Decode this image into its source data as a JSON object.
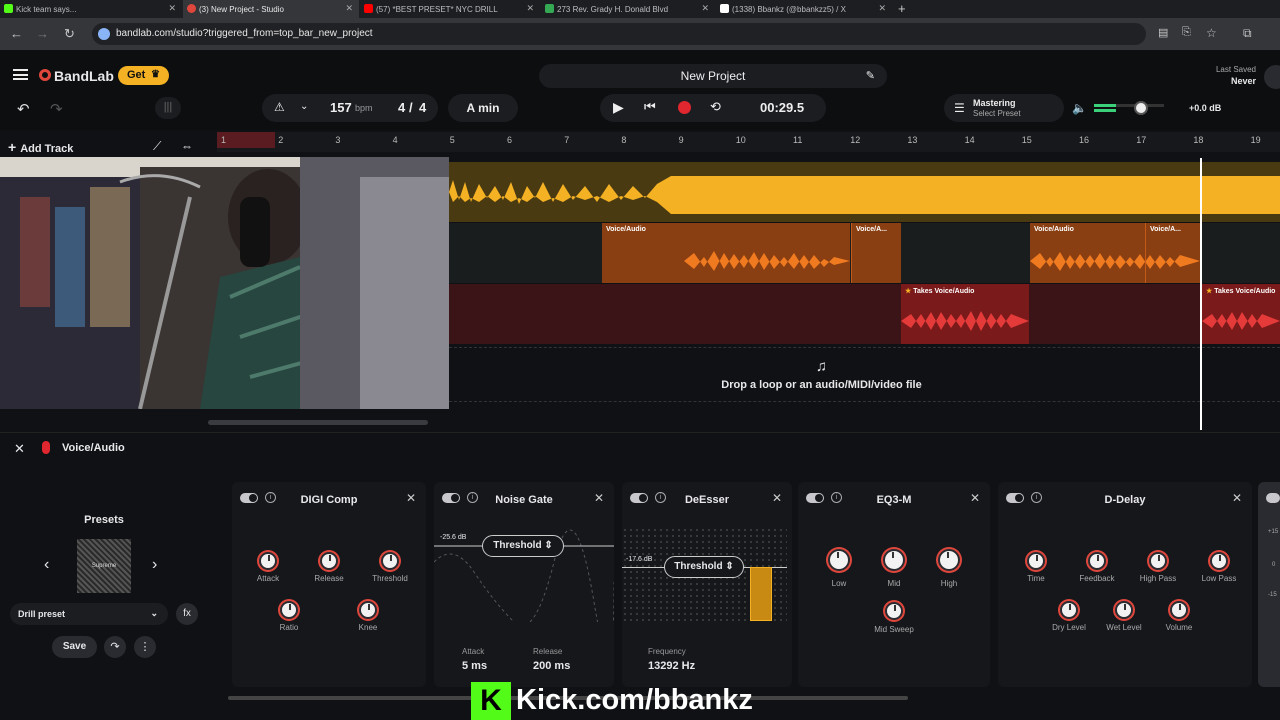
{
  "browser": {
    "tabs": [
      {
        "label": "Kick team says...",
        "color": "#53fc18"
      },
      {
        "label": "(3) New Project - Studio",
        "color": "#e0473c"
      },
      {
        "label": "(57) *BEST PRESET* NYC DRILL",
        "color": "#ff0000"
      },
      {
        "label": "273 Rev. Grady H. Donald Blvd",
        "color": "#34a853"
      },
      {
        "label": "(1338) Bbankz (@bbankzz5) / X",
        "color": "#ffffff"
      }
    ],
    "url": "bandlab.com/studio?triggered_from=top_bar_new_project",
    "new_tab": "+"
  },
  "header": {
    "brand": "BandLab",
    "get_label": "Get",
    "project_title": "New Project",
    "last_saved_label": "Last Saved",
    "last_saved_value": "Never",
    "bpm": "157",
    "bpm_unit": "bpm",
    "time_sig_num": "4",
    "time_sig_sep": "/",
    "time_sig_den": "4",
    "key": "A min",
    "time": "00:29.5",
    "mastering_label": "Mastering",
    "mastering_preset": "Select Preset",
    "volume_db": "+0.0 dB",
    "volume_level": 0.62
  },
  "timeline": {
    "add_track": "Add Track",
    "bars": [
      "1",
      "2",
      "3",
      "4",
      "5",
      "6",
      "7",
      "8",
      "9",
      "10",
      "11",
      "12",
      "13",
      "14",
      "15",
      "16",
      "17",
      "18",
      "19"
    ],
    "clip_label": "Voice/Audio",
    "clip_label_short": "Voice/A...",
    "takes": "Takes",
    "drop_hint": "Drop a loop or an audio/MIDI/video file"
  },
  "panel": {
    "track_name": "Voice/Audio",
    "presets_label": "Presets",
    "preset_thumb": "Supreme",
    "preset_name": "Drill preset",
    "save": "Save"
  },
  "effects": [
    {
      "name": "DIGI Comp",
      "knobs": [
        "Attack",
        "Release",
        "Threshold",
        "Ratio",
        "Knee"
      ]
    },
    {
      "name": "Noise Gate",
      "threshold_label": "Threshold",
      "threshold_db": "-25.6 dB",
      "attack_label": "Attack",
      "attack_value": "5 ms",
      "release_label": "Release",
      "release_value": "200 ms"
    },
    {
      "name": "DeEsser",
      "threshold_label": "Threshold",
      "threshold_db": "-17.6 dB",
      "freq_label": "Frequency",
      "freq_value": "13292 Hz"
    },
    {
      "name": "EQ3-M",
      "knobs": [
        "Low",
        "Mid",
        "High",
        "Mid Sweep"
      ]
    },
    {
      "name": "D-Delay",
      "knobs": [
        "Time",
        "Feedback",
        "High Pass",
        "Low Pass",
        "Dry Level",
        "Wet Level",
        "Volume"
      ]
    }
  ],
  "partial_fx": {
    "ticks": [
      "+15",
      "0",
      "-15"
    ]
  },
  "overlay": {
    "text": "Kick.com/bbankz",
    "badge": "K"
  },
  "colors": {
    "accent": "#e0473c",
    "yellow": "#f4b123",
    "orange": "#e8701d",
    "red": "#d42a2a",
    "kick": "#53fc18"
  }
}
